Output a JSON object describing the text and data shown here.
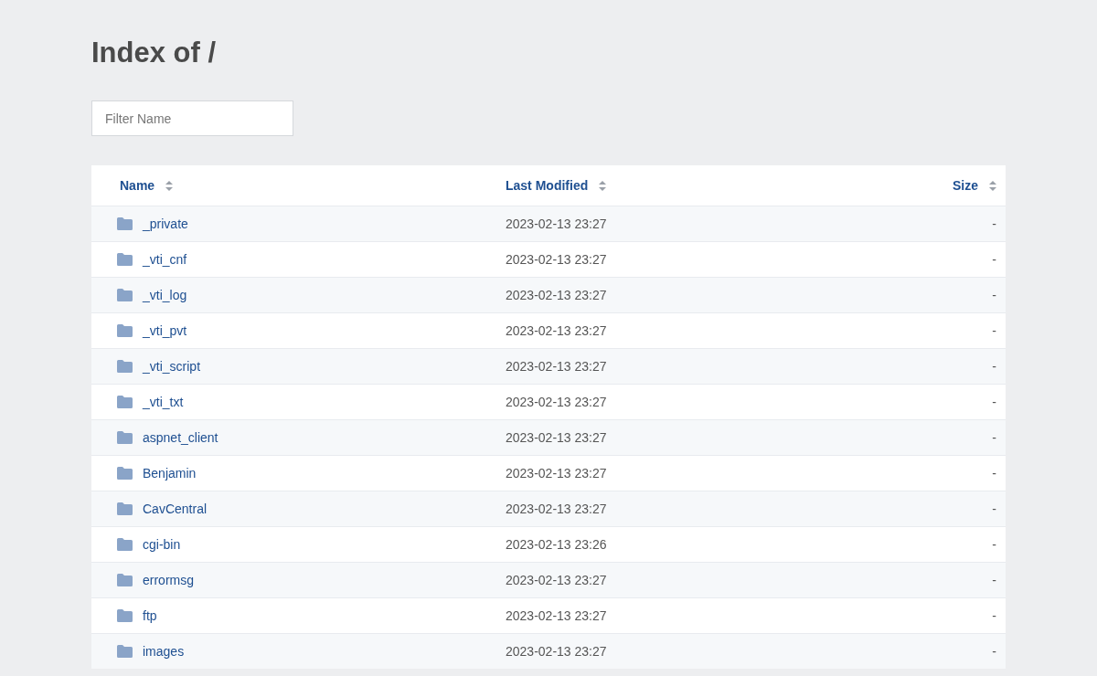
{
  "title": "Index of /",
  "filter": {
    "placeholder": "Filter Name"
  },
  "columns": [
    {
      "label": "Name"
    },
    {
      "label": "Last Modified"
    },
    {
      "label": "Size"
    }
  ],
  "rows": [
    {
      "name": "_private",
      "modified": "2023-02-13 23:27",
      "size": "-"
    },
    {
      "name": "_vti_cnf",
      "modified": "2023-02-13 23:27",
      "size": "-"
    },
    {
      "name": "_vti_log",
      "modified": "2023-02-13 23:27",
      "size": "-"
    },
    {
      "name": "_vti_pvt",
      "modified": "2023-02-13 23:27",
      "size": "-"
    },
    {
      "name": "_vti_script",
      "modified": "2023-02-13 23:27",
      "size": "-"
    },
    {
      "name": "_vti_txt",
      "modified": "2023-02-13 23:27",
      "size": "-"
    },
    {
      "name": "aspnet_client",
      "modified": "2023-02-13 23:27",
      "size": "-"
    },
    {
      "name": "Benjamin",
      "modified": "2023-02-13 23:27",
      "size": "-"
    },
    {
      "name": "CavCentral",
      "modified": "2023-02-13 23:27",
      "size": "-"
    },
    {
      "name": "cgi-bin",
      "modified": "2023-02-13 23:26",
      "size": "-"
    },
    {
      "name": "errormsg",
      "modified": "2023-02-13 23:27",
      "size": "-"
    },
    {
      "name": "ftp",
      "modified": "2023-02-13 23:27",
      "size": "-"
    },
    {
      "name": "images",
      "modified": "2023-02-13 23:27",
      "size": "-"
    }
  ]
}
